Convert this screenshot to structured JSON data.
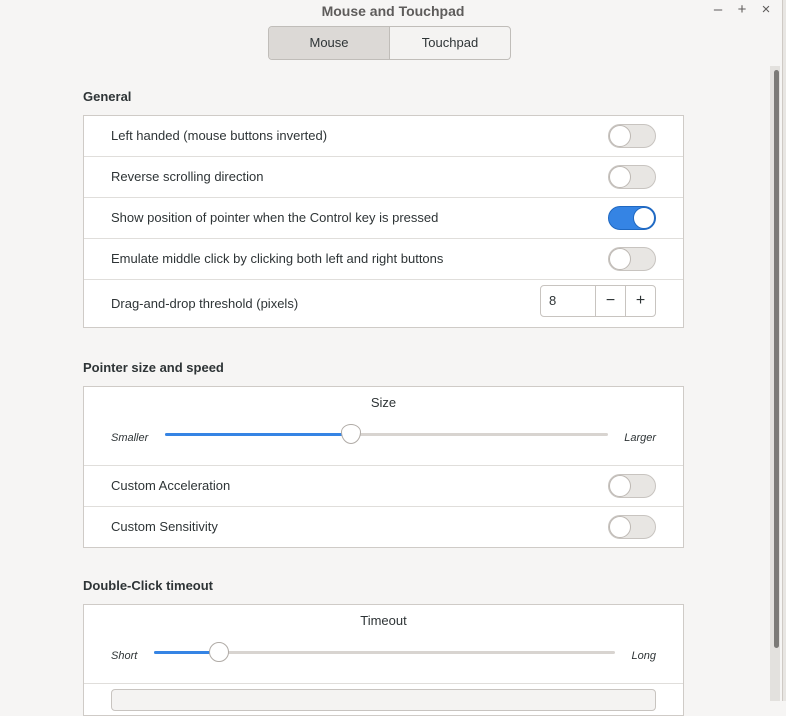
{
  "window": {
    "title": "Mouse and Touchpad"
  },
  "stack_switcher": {
    "tabs": [
      "Mouse",
      "Touchpad"
    ],
    "active": "Mouse"
  },
  "general": {
    "title": "General",
    "rows": [
      {
        "label": "Left handed (mouse buttons inverted)",
        "on": false
      },
      {
        "label": "Reverse scrolling direction",
        "on": false
      },
      {
        "label": "Show position of pointer when the Control key is pressed",
        "on": true
      },
      {
        "label": "Emulate middle click by clicking both left and right buttons",
        "on": false
      }
    ],
    "threshold": {
      "label": "Drag-and-drop threshold (pixels)",
      "value": "8",
      "minus": "−",
      "plus": "+"
    }
  },
  "pointer": {
    "title": "Pointer size and speed",
    "size": {
      "title": "Size",
      "min_label": "Smaller",
      "max_label": "Larger",
      "level": 0.42
    },
    "rows": [
      {
        "label": "Custom Acceleration",
        "on": false
      },
      {
        "label": "Custom Sensitivity",
        "on": false
      }
    ]
  },
  "doubleclick": {
    "title": "Double-Click timeout",
    "timeout": {
      "title": "Timeout",
      "min_label": "Short",
      "max_label": "Long",
      "level": 0.14
    }
  },
  "window_controls": {
    "minimize": "–",
    "maximize": "+",
    "close": "×"
  },
  "colors": {
    "accent": "#3584e4",
    "background": "#f6f5f4"
  }
}
